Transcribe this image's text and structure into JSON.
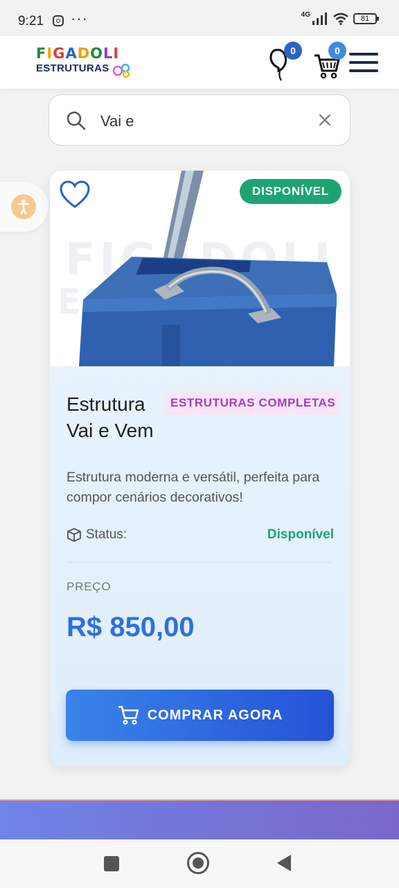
{
  "status_bar": {
    "time": "9:21",
    "dots": "···",
    "network": "4G",
    "battery": "81"
  },
  "header": {
    "logo_top": [
      "F",
      "I",
      "G",
      "A",
      "D",
      "O",
      "L",
      "I"
    ],
    "logo_bottom": "ESTRUTURAS",
    "favorites_count": "0",
    "cart_count": "0"
  },
  "search": {
    "value": "Vai e",
    "placeholder": ""
  },
  "product": {
    "availability_badge": "DISPONÍVEL",
    "title": "Estrutura Vai e Vem",
    "category": "ESTRUTURAS COMPLETAS",
    "description": "Estrutura moderna e versátil, perfeita para compor cenários decorativos!",
    "status_label": "Status:",
    "status_value": "Disponível",
    "price_label": "PREÇO",
    "price": "R$ 850,00",
    "buy_label": "COMPRAR AGORA"
  },
  "colors": {
    "brand_blue": "#2f6fe0",
    "available_green": "#1ca571",
    "category_purple": "#a53cc0"
  },
  "icons": [
    "instagram-icon",
    "signal-icon",
    "wifi-icon",
    "battery-icon",
    "balloon-icon",
    "cart-icon",
    "menu-icon",
    "search-icon",
    "close-icon",
    "accessibility-icon",
    "heart-icon",
    "box-icon",
    "cart-icon"
  ]
}
